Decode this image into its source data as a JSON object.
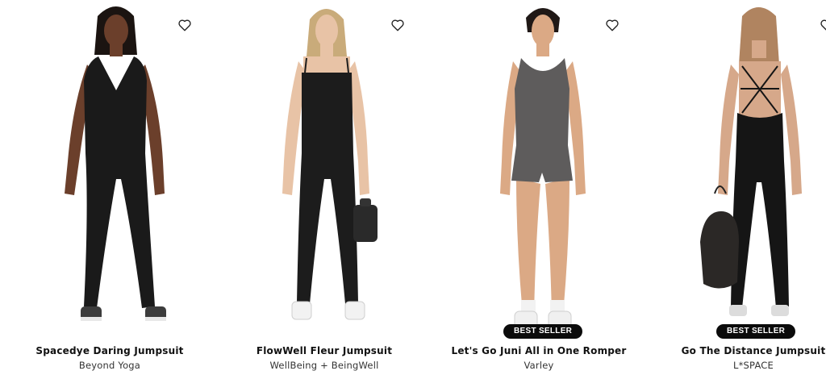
{
  "colors": {
    "background": "#ffffff",
    "badge_bg": "#0b0b0b",
    "badge_text": "#ffffff",
    "title_text": "#111111",
    "brand_text": "#333333"
  },
  "products": [
    {
      "title": "Spacedye Daring Jumpsuit",
      "brand": "Beyond Yoga",
      "badge": "",
      "wishlist_icon": "heart-outline-icon",
      "garment_color": "#1a1a1a"
    },
    {
      "title": "FlowWell Fleur Jumpsuit",
      "brand": "WellBeing + BeingWell",
      "badge": "",
      "wishlist_icon": "heart-outline-icon",
      "garment_color": "#1c1c1c"
    },
    {
      "title": "Let's Go Juni All in One Romper",
      "brand": "Varley",
      "badge": "BEST SELLER",
      "wishlist_icon": "heart-outline-icon",
      "garment_color": "#5e5c5c"
    },
    {
      "title": "Go The Distance Jumpsuit",
      "brand": "L*SPACE",
      "badge": "BEST SELLER",
      "wishlist_icon": "heart-outline-icon",
      "garment_color": "#151515"
    }
  ]
}
